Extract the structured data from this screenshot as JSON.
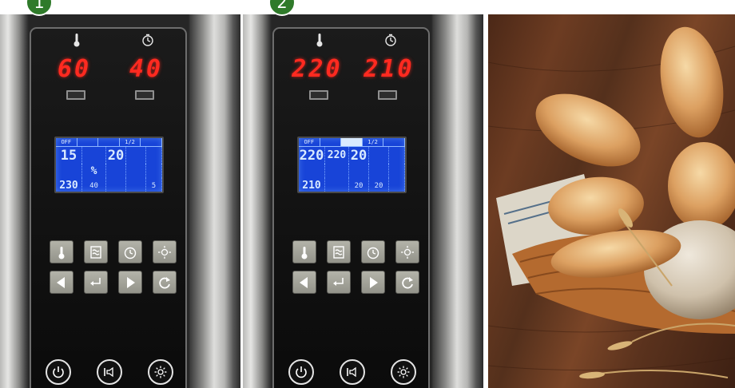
{
  "panels": [
    {
      "badge": "1",
      "led_left": "60",
      "led_right": "40",
      "lcd": {
        "tabs": [
          "OFF",
          "",
          "",
          "1/2",
          ""
        ],
        "active_tab": -1,
        "row1": [
          "15",
          "",
          "20",
          "",
          ""
        ],
        "row2": [
          "",
          "%",
          "",
          "",
          ""
        ],
        "row3": [
          "230",
          "40",
          "",
          "",
          "5"
        ]
      }
    },
    {
      "badge": "2",
      "led_left": "220",
      "led_right": "210",
      "lcd": {
        "tabs": [
          "OFF",
          "",
          "",
          "1/2",
          ""
        ],
        "active_tab": 2,
        "row1": [
          "220",
          "220",
          "20",
          "",
          ""
        ],
        "row2": [
          "",
          "",
          "",
          "",
          ""
        ],
        "row3": [
          "210",
          "",
          "20",
          "20",
          ""
        ]
      }
    }
  ],
  "colors": {
    "led": "#ff2a20",
    "lcd_background": "#1844d8",
    "badge": "#2f7a2a",
    "key": "#a3a39a"
  },
  "icons": {
    "led_labels": [
      "thermometer-icon",
      "timer-icon"
    ],
    "keys_row1": [
      "thermometer-key-icon",
      "steam-mode-icon",
      "timer-key-icon",
      "light-sun-icon"
    ],
    "keys_row2": [
      "arrow-left-icon",
      "enter-return-icon",
      "arrow-right-icon",
      "refresh-cycle-icon"
    ],
    "round_buttons": [
      "power-icon",
      "sound-icon",
      "light-icon"
    ]
  }
}
